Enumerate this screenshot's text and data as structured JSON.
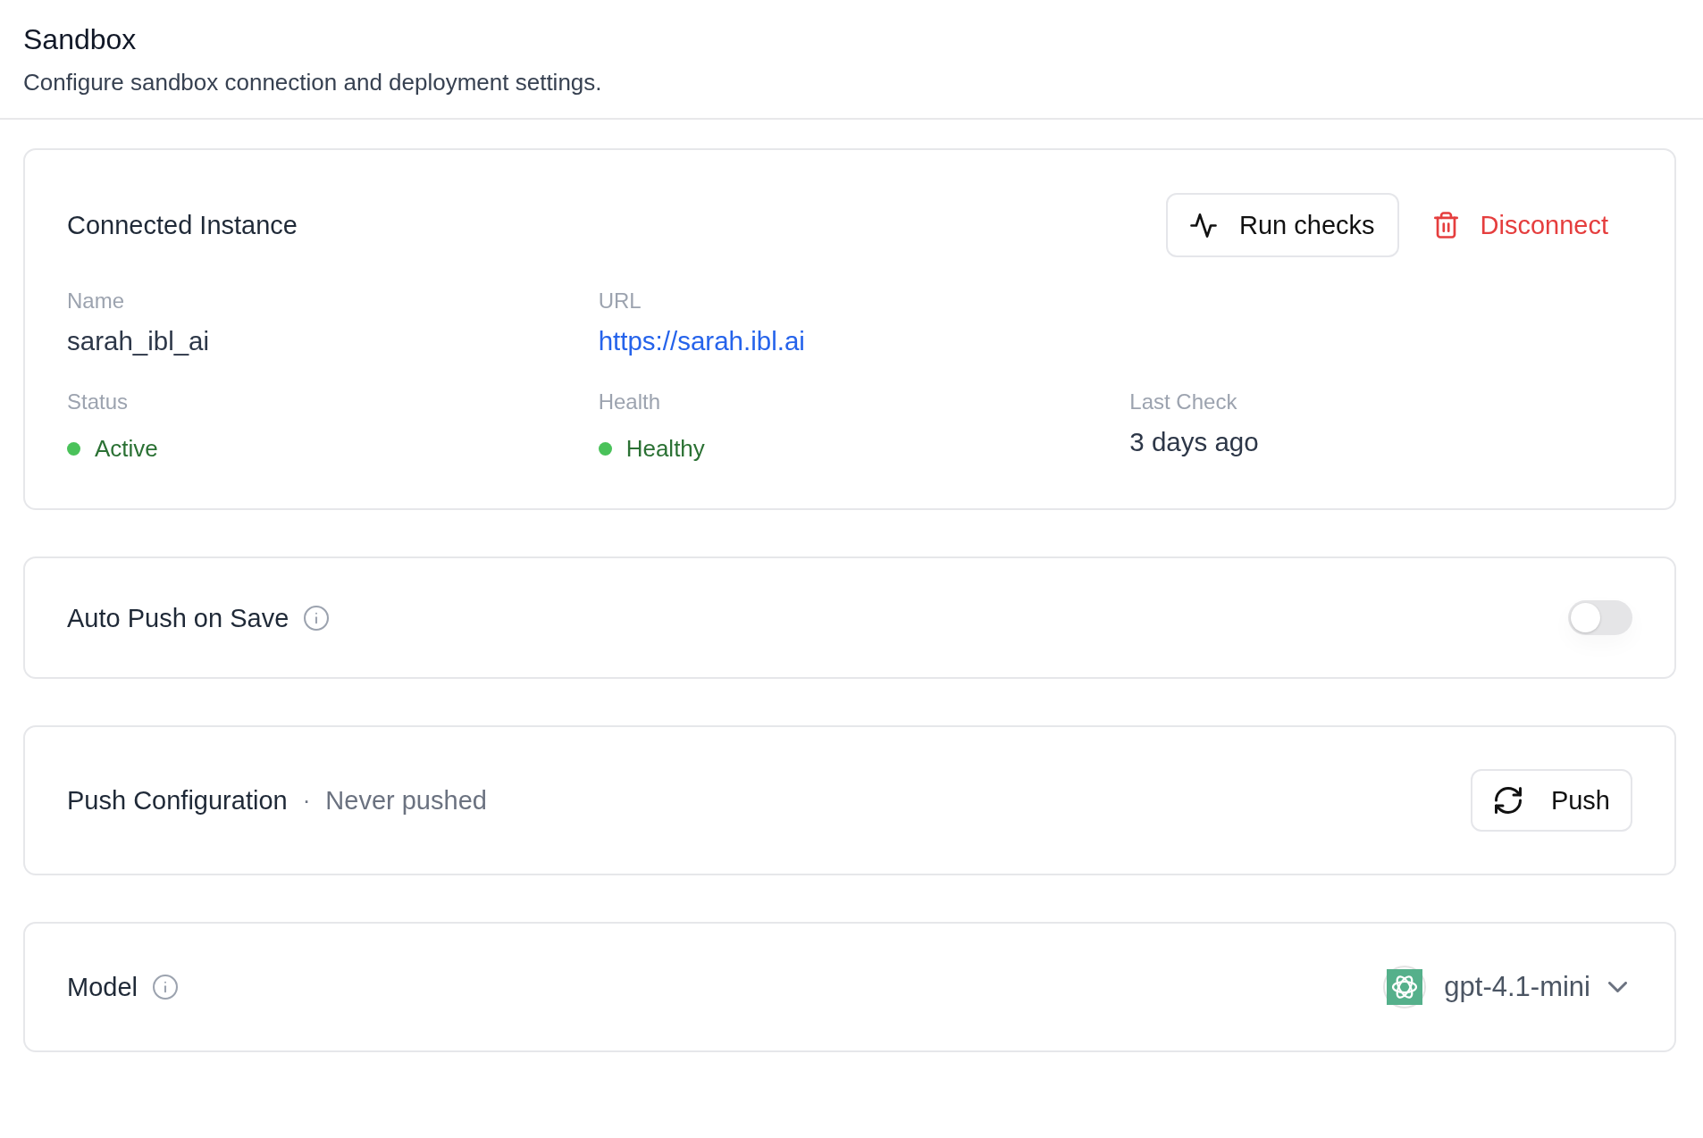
{
  "page": {
    "title": "Sandbox",
    "subtitle": "Configure sandbox connection and deployment settings."
  },
  "instance": {
    "title": "Connected Instance",
    "actions": [
      {
        "kind": "outline",
        "label": "Run checks"
      },
      {
        "kind": "danger",
        "label": "Disconnect"
      }
    ],
    "rows": [
      [
        {
          "kind": "text",
          "label": "Name",
          "value": "sarah_ibl_ai"
        },
        {
          "kind": "link",
          "label": "URL",
          "value": "https://sarah.ibl.ai"
        }
      ],
      [
        {
          "kind": "status",
          "label": "Status",
          "value": "Active",
          "color": "#4ac25a"
        },
        {
          "kind": "status",
          "label": "Health",
          "value": "Healthy",
          "color": "#4ac25a"
        },
        {
          "kind": "text",
          "label": "Last Check",
          "value": "3 days ago"
        }
      ]
    ]
  },
  "auto_push": {
    "label": "Auto Push on Save",
    "on": false
  },
  "push_config": {
    "label": "Push Configuration",
    "separator": "·",
    "status": "Never pushed",
    "button": "Push"
  },
  "model": {
    "label": "Model",
    "value": "gpt-4.1-mini"
  }
}
